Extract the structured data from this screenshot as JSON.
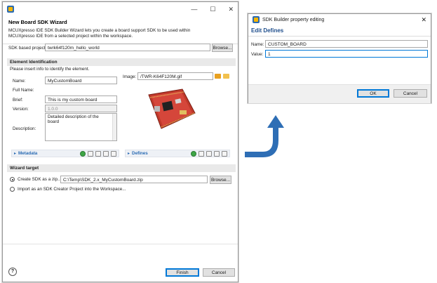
{
  "wizard": {
    "title": "",
    "header_title": "New Board SDK Wizard",
    "header_desc_1": "MCUXpresso IDE SDK Builder Wizard lets you create a board support SDK to be used within",
    "header_desc_2": "MCUXpresso IDE from a selected project within the workspace.",
    "sdk_project_label": "SDK based project",
    "sdk_project_value": "twrk64f120m_hello_world",
    "browse_label": "Browse...",
    "element_group_title": "Element Identification",
    "element_hint": "Please insert info to identify the element.",
    "name_label": "Name:",
    "name_value": "MyCustomBoard",
    "fullname_label": "Full Name:",
    "brief_label": "Brief:",
    "brief_value": "This is my custom board",
    "version_label": "Version:",
    "version_value": "1.0.0",
    "description_label": "Description:",
    "description_value_1": "Detailed description of the",
    "description_value_2": "board",
    "image_label": "Image:",
    "image_value": "/TWR-K64F120M.gif",
    "metadata_label": "Metadata",
    "defines_label": "Defines",
    "target_group_title": "Wizard target",
    "create_sdk_label": "Create SDK as a zip...",
    "create_sdk_path": "C:\\Temp\\SDK_2.x_MyCustomBoard.zip",
    "browse2_label": "Browse...",
    "import_label": "Import as an SDK Creator Project into the Workspace...",
    "finish_label": "Finish",
    "cancel_label": "Cancel",
    "help_glyph": "?"
  },
  "editor": {
    "title": "SDK Builder property editing",
    "header_title": "Edit Defines",
    "name_label": "Name:",
    "name_value": "CUSTOM_BOARD",
    "value_label": "Value:",
    "value_value": "1",
    "ok_label": "OK",
    "cancel_label": "Cancel"
  },
  "titlebar_glyphs": {
    "minimize": "—",
    "maximize": "☐",
    "close": "✕"
  },
  "colors": {
    "accent": "#2a6bb3",
    "arrow": "#2e6eb5",
    "ok_border": "#0078d7"
  }
}
